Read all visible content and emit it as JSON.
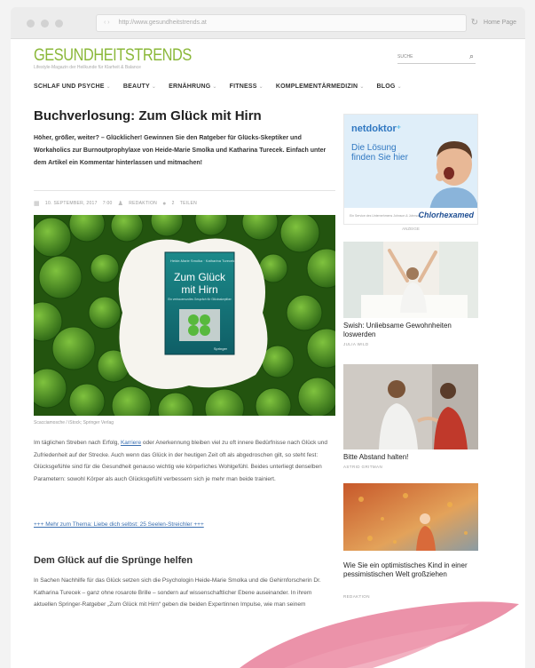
{
  "browser": {
    "url": "http://www.gesundheitstrends.at",
    "home_label": "Home Page"
  },
  "site": {
    "logo": "GESUNDHEITSTRENDS",
    "tagline": "Lifestyle-Magazin der Heilkunde für Klarheit & Balance",
    "search_placeholder": "SUCHE"
  },
  "menu": [
    {
      "label": "SCHLAF UND PSYCHE"
    },
    {
      "label": "BEAUTY"
    },
    {
      "label": "ERNÄHRUNG"
    },
    {
      "label": "FITNESS"
    },
    {
      "label": "KOMPLEMENTÄRMEDIZIN"
    },
    {
      "label": "BLOG"
    }
  ],
  "article": {
    "title": "Buchverlosung: Zum Glück mit Hirn",
    "lead": "Höher, größer, weiter? – Glücklicher! Gewinnen Sie den Ratgeber für Glücks-Skeptiker und Workaholics zur Burnoutprophylaxe von Heide-Marie Smolka und Katharina Turecek. Einfach unter dem Artikel ein Kommentar hinterlassen und mitmachen!",
    "meta": {
      "date": "10. SEPTEMBER, 2017",
      "time": "7:00",
      "author": "REDAKTION",
      "comments": "2",
      "share": "TEILEN"
    },
    "book": {
      "authors": "Heide-Marie Smolka · Katharina Turecek",
      "title_line1": "Zum Glück",
      "title_line2": "mit Hirn",
      "subtitle": "Ein vertrauensvolles Gespräch für Glücksskeptiker",
      "publisher": "Springer"
    },
    "image_credit": "Scacciamosche / iStock; Springer Verlag",
    "para1_before": "Im täglichen Streben nach Erfolg,",
    "para1_link": "Karriere",
    "para1_after": "oder Anerkennung bleiben viel zu oft innere Bedürfnisse nach Glück und Zufriedenheit auf der Strecke. Auch wenn das Glück in der heutigen Zeit oft als abgedroschen gilt, so steht fest: Glücksgefühle sind für die Gesundheit genauso wichtig wie körperliches Wohlgefühl. Beides unterliegt denselben Parametern: sowohl Körper als auch Glücksgefühl verbessern sich je mehr man beide trainiert.",
    "more_link": "+++ Mehr zum Thema: Liebe dich selbst: 25 Seelen-Streichler +++",
    "subheading": "Dem Glück auf die Sprünge helfen",
    "para2": "In Sachen Nachhilfe für das Glück setzen sich die Psychologin Heide-Marie Smolka und die Gehirnforscherin Dr. Katharina Turecek – ganz ohne rosarote Brille – sondern auf wissenschaftlicher Ebene auseinander. In ihrem aktuellen Springer-Ratgeber „Zum Glück mit Hirn“ geben die beiden Expertinnen Impulse, wie man seinem"
  },
  "ad": {
    "brand": "netdoktor",
    "text": "Die Lösung finden Sie hier",
    "footer_small": "Ein Service des Unternehmens Johnson & Johnson",
    "footer_brand": "Chlorhexamed",
    "label": "ANZEIGE"
  },
  "sidebar_cards": [
    {
      "title": "Swish: Unliebsame Gewohnheiten loswerden",
      "author": "JULIA WILD"
    },
    {
      "title": "Bitte Abstand halten!",
      "author": "ASTRID GRITMAN"
    },
    {
      "title": "Wie Sie ein optimistisches Kind in einer pessimistischen Welt großziehen",
      "author": "REDAKTION"
    }
  ],
  "colors": {
    "brand_green": "#8bb83a",
    "link_blue": "#3a6fb0",
    "accent_pink": "#e87f9a"
  }
}
